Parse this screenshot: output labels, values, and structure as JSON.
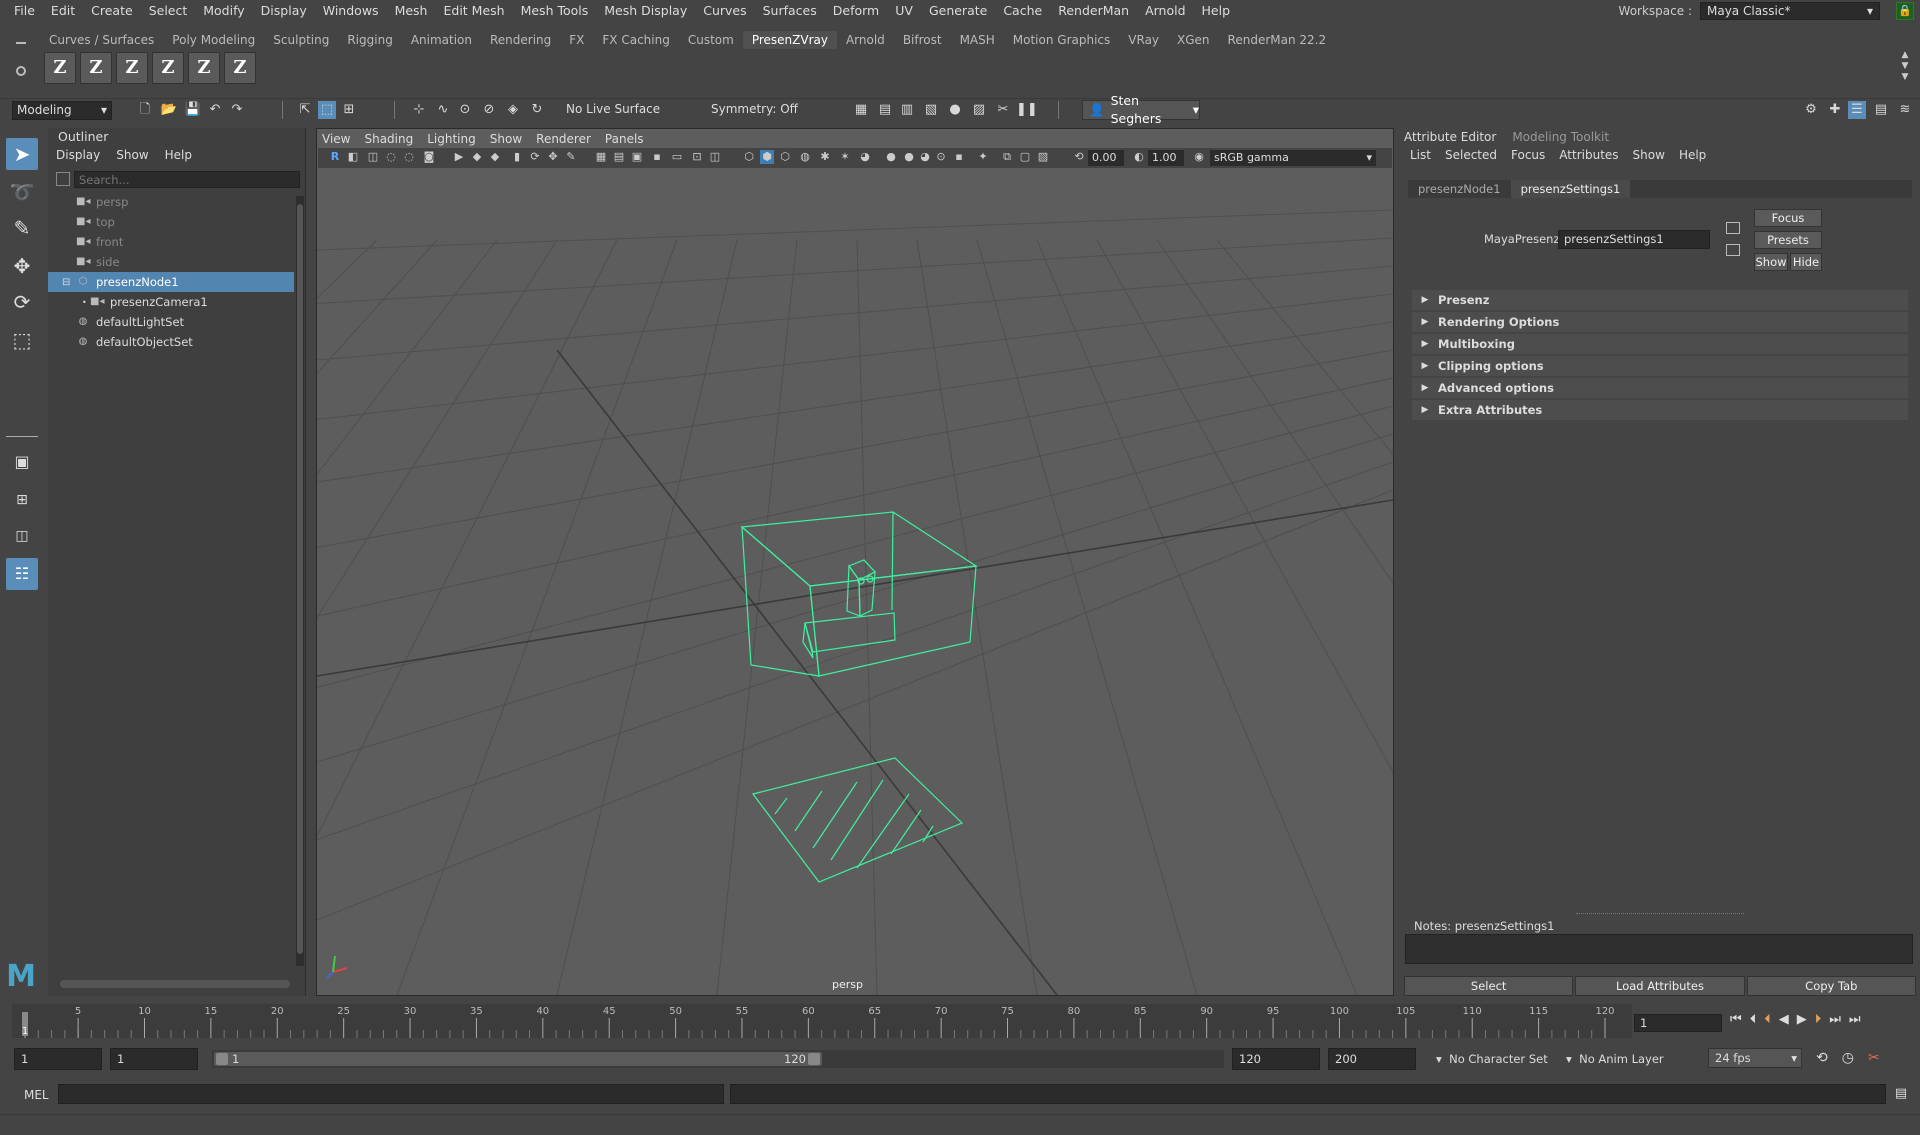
{
  "menubar": {
    "items": [
      "File",
      "Edit",
      "Create",
      "Select",
      "Modify",
      "Display",
      "Windows",
      "Mesh",
      "Edit Mesh",
      "Mesh Tools",
      "Mesh Display",
      "Curves",
      "Surfaces",
      "Deform",
      "UV",
      "Generate",
      "Cache",
      "RenderMan",
      "Arnold",
      "Help"
    ],
    "workspace_label": "Workspace :",
    "workspace_value": "Maya Classic*"
  },
  "shelf": {
    "tabs": [
      "Curves / Surfaces",
      "Poly Modeling",
      "Sculpting",
      "Rigging",
      "Animation",
      "Rendering",
      "FX",
      "FX Caching",
      "Custom",
      "PresenZVray",
      "Arnold",
      "Bifrost",
      "MASH",
      "Motion Graphics",
      "VRay",
      "XGen",
      "RenderMan 22.2"
    ],
    "active_tab": "PresenZVray",
    "icons": [
      "Z",
      "Z",
      "Z",
      "Z",
      "Z",
      "Z"
    ]
  },
  "statusline": {
    "mode": "Modeling",
    "live_surface": "No Live Surface",
    "symmetry": "Symmetry: Off",
    "user": "Sten Seghers"
  },
  "outliner": {
    "title": "Outliner",
    "menu": [
      "Display",
      "Show",
      "Help"
    ],
    "search_placeholder": "Search...",
    "nodes": [
      {
        "label": "persp",
        "icon": "camera-icon",
        "dim": true
      },
      {
        "label": "top",
        "icon": "camera-icon",
        "dim": true
      },
      {
        "label": "front",
        "icon": "camera-icon",
        "dim": true
      },
      {
        "label": "side",
        "icon": "camera-icon",
        "dim": true
      },
      {
        "label": "presenzNode1",
        "icon": "group-icon",
        "selected": true
      },
      {
        "label": "presenzCamera1",
        "icon": "camera-icon",
        "child": true
      },
      {
        "label": "defaultLightSet",
        "icon": "set-icon"
      },
      {
        "label": "defaultObjectSet",
        "icon": "set-icon"
      }
    ]
  },
  "viewport": {
    "menu": [
      "View",
      "Shading",
      "Lighting",
      "Show",
      "Renderer",
      "Panels"
    ],
    "exposure": "0.00",
    "gamma": "1.00",
    "color_space": "sRGB gamma",
    "camera_label": "persp",
    "wire_color": "#3ef0a0"
  },
  "attribute_editor": {
    "tabs": [
      "Attribute Editor",
      "Modeling Toolkit"
    ],
    "active_tab": "Attribute Editor",
    "menu": [
      "List",
      "Selected",
      "Focus",
      "Attributes",
      "Show",
      "Help"
    ],
    "node_tabs": [
      "presenzNode1",
      "presenzSettings1"
    ],
    "active_node_tab": "presenzSettings1",
    "field_label": "MayaPresenz:",
    "field_value": "presenzSettings1",
    "focus_btn": "Focus",
    "presets_btn": "Presets",
    "show_btn": "Show",
    "hide_btn": "Hide",
    "sections": [
      "Presenz",
      "Rendering Options",
      "Multiboxing",
      "Clipping options",
      "Advanced options",
      "Extra Attributes"
    ],
    "notes_label": "Notes:  presenzSettings1",
    "bottom_buttons": [
      "Select",
      "Load Attributes",
      "Copy Tab"
    ]
  },
  "timeslider": {
    "ticks": [
      "1",
      "5",
      "10",
      "15",
      "20",
      "25",
      "30",
      "35",
      "40",
      "45",
      "50",
      "55",
      "60",
      "65",
      "70",
      "75",
      "80",
      "85",
      "90",
      "95",
      "100",
      "105",
      "110",
      "115",
      "120"
    ],
    "current_frame": "1"
  },
  "rangeslider": {
    "start_time": "1",
    "range_start": "1",
    "range_start_label": "1",
    "range_end_label": "120",
    "range_end": "120",
    "end_time": "200",
    "character_set": "No Character Set",
    "anim_layer": "No Anim Layer",
    "fps": "24 fps"
  },
  "cmdline": {
    "lang": "MEL",
    "input_value": ""
  }
}
